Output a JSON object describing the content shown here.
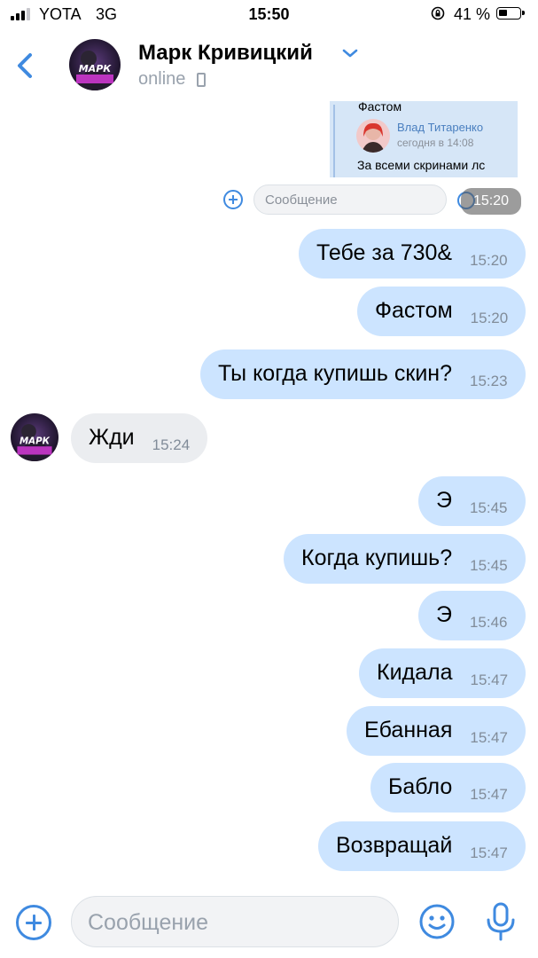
{
  "status_bar": {
    "carrier": "YOTA",
    "network": "3G",
    "time": "15:50",
    "battery_percent": "41 %",
    "battery_level": 0.41
  },
  "header": {
    "contact_name": "Марк Кривицкий",
    "presence": "online",
    "avatar_text": "МАРК"
  },
  "forwarded_fragment": {
    "top_text": "Фастом",
    "author": "Влад Титаренко",
    "date": "сегодня в 14:08",
    "text": "За всеми скринами лс",
    "input_placeholder": "Сообщение",
    "time_badge": "15:20"
  },
  "messages": [
    {
      "direction": "out",
      "text": "Тебе за 730&",
      "time": "15:20"
    },
    {
      "direction": "out",
      "text": "Фастом",
      "time": "15:20"
    },
    {
      "direction": "out",
      "text": "Ты когда купишь скин?",
      "time": "15:23"
    },
    {
      "direction": "in",
      "text": "Жди",
      "time": "15:24"
    },
    {
      "direction": "out",
      "text": "Э",
      "time": "15:45"
    },
    {
      "direction": "out",
      "text": "Когда купишь?",
      "time": "15:45"
    },
    {
      "direction": "out",
      "text": "Э",
      "time": "15:46"
    },
    {
      "direction": "out",
      "text": "Кидала",
      "time": "15:47"
    },
    {
      "direction": "out",
      "text": "Ебанная",
      "time": "15:47"
    },
    {
      "direction": "out",
      "text": "Бабло",
      "time": "15:47"
    },
    {
      "direction": "out",
      "text": "Возвращай",
      "time": "15:47"
    }
  ],
  "composer": {
    "placeholder": "Сообщение"
  },
  "colors": {
    "accent": "#3f8ae0",
    "outgoing_bubble": "#cce4ff",
    "incoming_bubble": "#ebedf0",
    "time_text": "#818c99"
  }
}
